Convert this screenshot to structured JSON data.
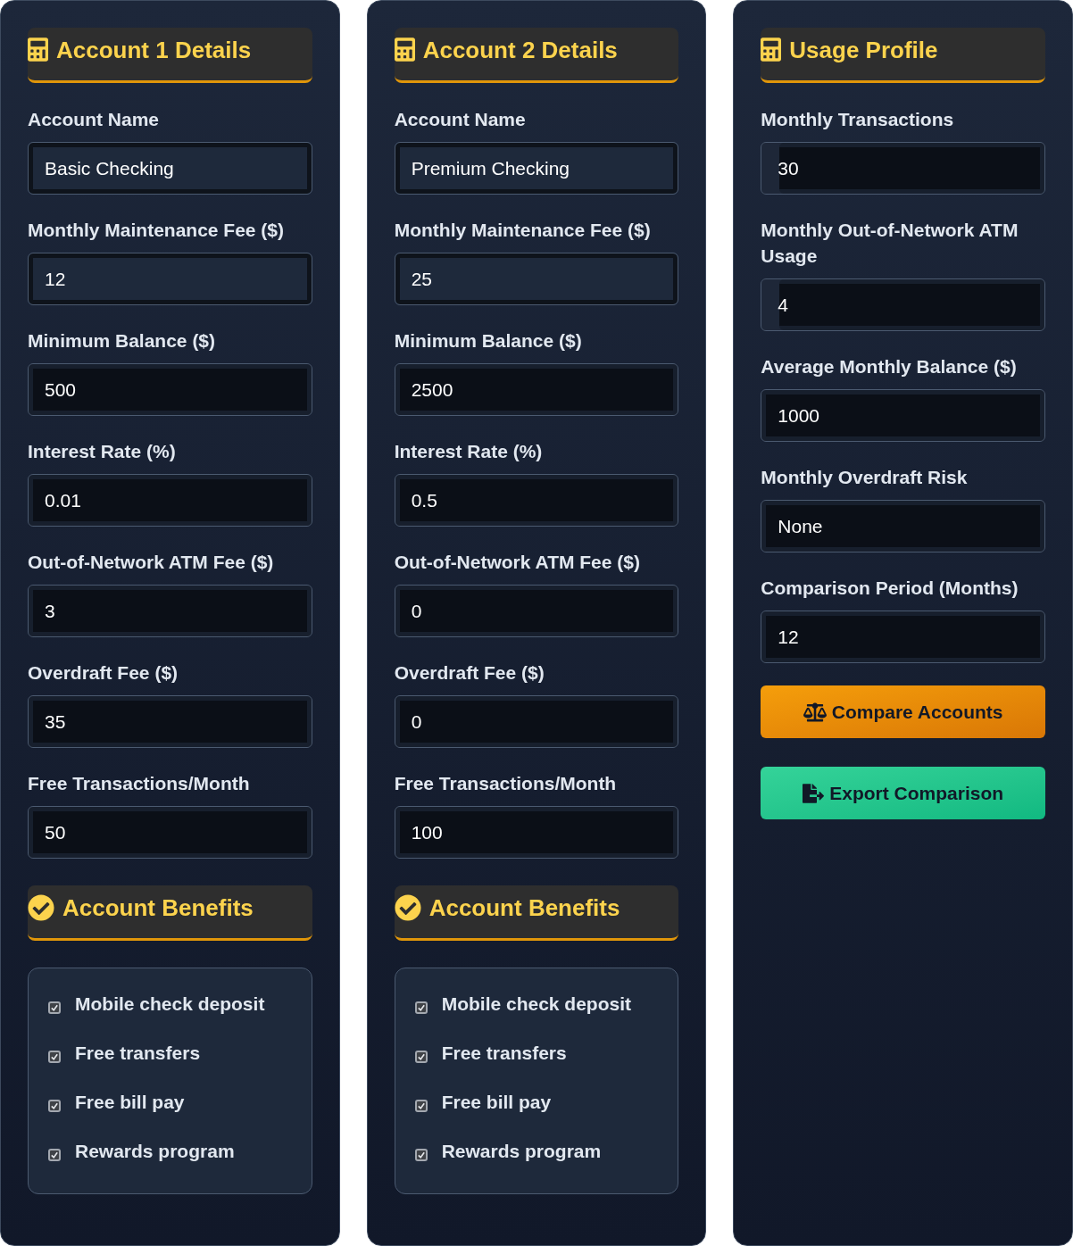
{
  "panels": [
    {
      "kind": "account",
      "title": "Account 1 Details",
      "fields": [
        {
          "label": "Account Name",
          "value": "Basic Checking",
          "kind": "plain"
        },
        {
          "label": "Monthly Maintenance Fee ($)",
          "value": "12",
          "kind": "plain"
        },
        {
          "label": "Minimum Balance ($)",
          "value": "500",
          "kind": "dark"
        },
        {
          "label": "Interest Rate (%)",
          "value": "0.01",
          "kind": "dark"
        },
        {
          "label": "Out-of-Network ATM Fee ($)",
          "value": "3",
          "kind": "dark"
        },
        {
          "label": "Overdraft Fee ($)",
          "value": "35",
          "kind": "dark"
        },
        {
          "label": "Free Transactions/Month",
          "value": "50",
          "kind": "dark"
        }
      ],
      "benefits": {
        "title": "Account Benefits",
        "items": [
          {
            "label": "Mobile check deposit",
            "checked": true
          },
          {
            "label": "Free transfers",
            "checked": true
          },
          {
            "label": "Free bill pay",
            "checked": true
          },
          {
            "label": "Rewards program",
            "checked": true
          }
        ]
      }
    },
    {
      "kind": "account",
      "title": "Account 2 Details",
      "fields": [
        {
          "label": "Account Name",
          "value": "Premium Checking",
          "kind": "plain"
        },
        {
          "label": "Monthly Maintenance Fee ($)",
          "value": "25",
          "kind": "plain"
        },
        {
          "label": "Minimum Balance ($)",
          "value": "2500",
          "kind": "dark"
        },
        {
          "label": "Interest Rate (%)",
          "value": "0.5",
          "kind": "dark"
        },
        {
          "label": "Out-of-Network ATM Fee ($)",
          "value": "0",
          "kind": "dark"
        },
        {
          "label": "Overdraft Fee ($)",
          "value": "0",
          "kind": "dark"
        },
        {
          "label": "Free Transactions/Month",
          "value": "100",
          "kind": "dark"
        }
      ],
      "benefits": {
        "title": "Account Benefits",
        "items": [
          {
            "label": "Mobile check deposit",
            "checked": true
          },
          {
            "label": "Free transfers",
            "checked": true
          },
          {
            "label": "Free bill pay",
            "checked": true
          },
          {
            "label": "Rewards program",
            "checked": true
          }
        ]
      }
    },
    {
      "kind": "usage",
      "title": "Usage Profile",
      "fields": [
        {
          "label": "Monthly Transactions",
          "value": "30",
          "kind": "striped"
        },
        {
          "label": "Monthly Out-of-Network ATM Usage",
          "value": "4",
          "kind": "striped"
        },
        {
          "label": "Average Monthly Balance ($)",
          "value": "1000",
          "kind": "dark"
        },
        {
          "label": "Monthly Overdraft Risk",
          "value": "None",
          "kind": "dark"
        },
        {
          "label": "Comparison Period (Months)",
          "value": "12",
          "kind": "dark"
        }
      ],
      "buttons": [
        {
          "label": "Compare Accounts",
          "kind": "compare"
        },
        {
          "label": "Export Comparison",
          "kind": "export"
        }
      ]
    }
  ]
}
